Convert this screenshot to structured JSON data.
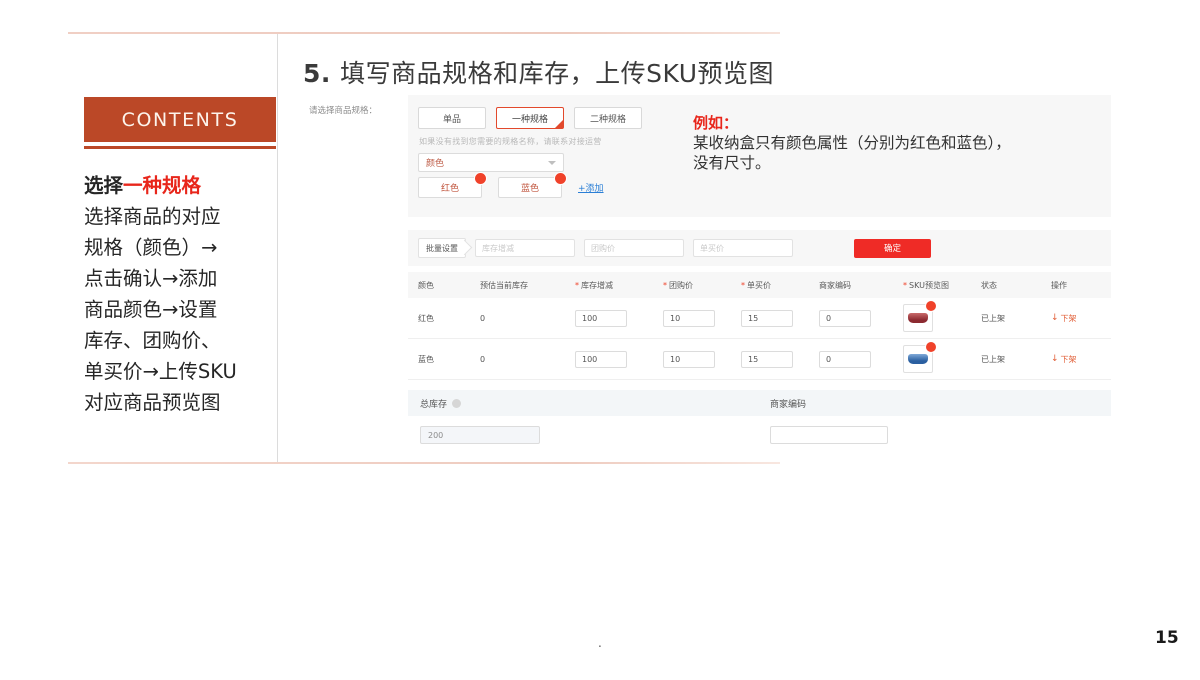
{
  "slide": {
    "heading_number": "5.",
    "heading_text": "填写商品规格和库存，上传SKU预览图",
    "page_number": "15",
    "footer_dot": "."
  },
  "sidebar": {
    "badge_label": "CONTENTS",
    "lines": [
      {
        "plain": "选择",
        "highlight": "一种规格"
      },
      {
        "plain": "选择商品的对应",
        "highlight": ""
      },
      {
        "plain": "规格（颜色）→",
        "highlight": ""
      },
      {
        "plain": "点击确认→添加",
        "highlight": ""
      },
      {
        "plain": "商品颜色→设置",
        "highlight": ""
      },
      {
        "plain": "库存、团购价、",
        "highlight": ""
      },
      {
        "plain": "单买价→上传SKU",
        "highlight": ""
      },
      {
        "plain": "对应商品预览图",
        "highlight": ""
      }
    ]
  },
  "screenshot": {
    "spec_section": {
      "label": "请选择商品规格：",
      "tabs": [
        {
          "label": "单品",
          "selected": false
        },
        {
          "label": "一种规格",
          "selected": true
        },
        {
          "label": "二种规格",
          "selected": false
        }
      ],
      "hint": "如果没有找到您需要的规格名称，请联系对接运营",
      "select_value": "颜色",
      "chips": [
        "红色",
        "蓝色"
      ],
      "add_link": "+添加"
    },
    "example_note": {
      "title": "例如：",
      "line1": "某收纳盒只有颜色属性（分别为红色和蓝色），",
      "line2": "没有尺寸。"
    },
    "batch_bar": {
      "tag_label": "批量设置",
      "fields": [
        {
          "placeholder": "库存增减"
        },
        {
          "placeholder": "团购价"
        },
        {
          "placeholder": "单买价"
        }
      ],
      "confirm_label": "确定"
    },
    "sku_table": {
      "headers": [
        {
          "label": "颜色",
          "required": false
        },
        {
          "label": "预估当前库存",
          "required": false
        },
        {
          "label": "库存增减",
          "required": true
        },
        {
          "label": "团购价",
          "required": true
        },
        {
          "label": "单买价",
          "required": true
        },
        {
          "label": "商家编码",
          "required": false
        },
        {
          "label": "SKU预览图",
          "required": true
        },
        {
          "label": "状态",
          "required": false
        },
        {
          "label": "操作",
          "required": false
        }
      ],
      "rows": [
        {
          "color": "红色",
          "estimated_stock": "0",
          "stock_change": "100",
          "group_price": "10",
          "single_price": "15",
          "merchant_code": "0",
          "preview_swatch": "red",
          "status": "已上架",
          "action": "下架"
        },
        {
          "color": "蓝色",
          "estimated_stock": "0",
          "stock_change": "100",
          "group_price": "10",
          "single_price": "15",
          "merchant_code": "0",
          "preview_swatch": "blue",
          "status": "已上架",
          "action": "下架"
        }
      ]
    },
    "totals_section": {
      "total_stock_label": "总库存",
      "total_stock_value": "200",
      "merchant_code_label": "商家编码",
      "merchant_code_value": ""
    }
  },
  "colors": {
    "brand_orange": "#bb4827",
    "highlight_red": "#e8261b",
    "accent_red": "#f0422a",
    "confirm_red": "#ef2b26",
    "link_blue": "#2b7fd6",
    "panel_gray": "#f7f7f7"
  }
}
